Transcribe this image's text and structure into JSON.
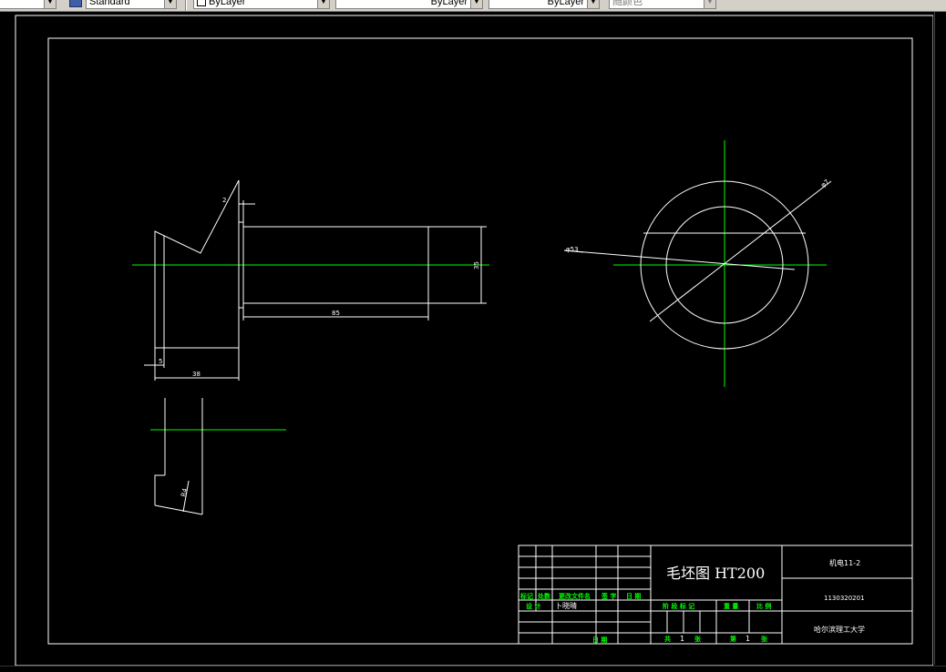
{
  "toolbar": {
    "text_style": "Standard",
    "layer": "ByLayer",
    "linetype": "ByLayer",
    "lineweight": "ByLayer",
    "plot_style": "随颜色"
  },
  "drawing": {
    "dimensions": {
      "d2": "2",
      "d5": "5",
      "d38": "38",
      "d85": "85",
      "d35": "35",
      "phi53": "φ53",
      "phi7x": "φ7",
      "r4": "R4"
    }
  },
  "title_block": {
    "title": "毛坯图 HT200",
    "class": "机电11-2",
    "student_id": "1130320201",
    "school": "哈尔滨理工大学",
    "header_labels": [
      "标记",
      "处数",
      "更改文件名",
      "签 字",
      "日 期"
    ],
    "design_label": "设 计",
    "designer": "卜晓晴",
    "date_label": "日 期",
    "stage_label": "阶 段 标 记",
    "weight_label": "重 量",
    "scale_label": "比 例",
    "total_label": "共",
    "total_value": "1",
    "total_unit": "张",
    "sheet_label": "第",
    "sheet_value": "1",
    "sheet_unit": "张"
  }
}
